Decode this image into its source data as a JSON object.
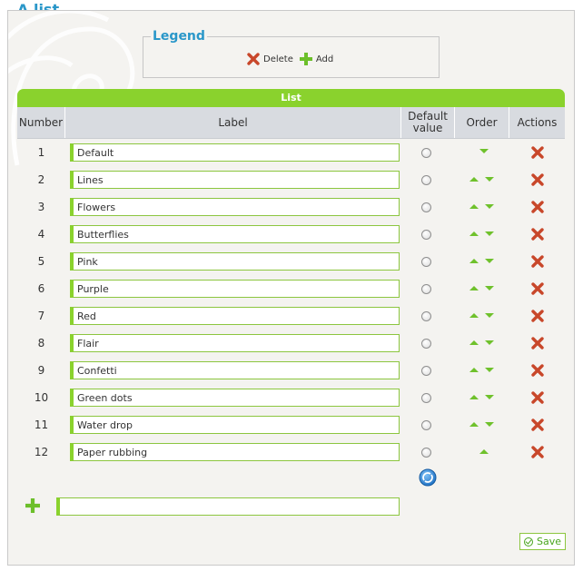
{
  "page": {
    "title": "A list"
  },
  "legend": {
    "title": "Legend",
    "delete_label": "Delete",
    "add_label": "Add"
  },
  "table": {
    "title": "List",
    "columns": [
      "Number",
      "Label",
      "Default value",
      "Order",
      "Actions"
    ],
    "rows": [
      {
        "number": "1",
        "label": "Default",
        "up": false,
        "down": true
      },
      {
        "number": "2",
        "label": "Lines",
        "up": true,
        "down": true
      },
      {
        "number": "3",
        "label": "Flowers",
        "up": true,
        "down": true
      },
      {
        "number": "4",
        "label": "Butterflies",
        "up": true,
        "down": true
      },
      {
        "number": "5",
        "label": "Pink",
        "up": true,
        "down": true
      },
      {
        "number": "6",
        "label": "Purple",
        "up": true,
        "down": true
      },
      {
        "number": "7",
        "label": "Red",
        "up": true,
        "down": true
      },
      {
        "number": "8",
        "label": "Flair",
        "up": true,
        "down": true
      },
      {
        "number": "9",
        "label": "Confetti",
        "up": true,
        "down": true
      },
      {
        "number": "10",
        "label": "Green dots",
        "up": true,
        "down": true
      },
      {
        "number": "11",
        "label": "Water drop",
        "up": true,
        "down": true
      },
      {
        "number": "12",
        "label": "Paper rubbing",
        "up": true,
        "down": false
      }
    ]
  },
  "new_item": {
    "value": ""
  },
  "actions": {
    "save_label": "Save"
  },
  "icons": {
    "delete": "delete-x-icon",
    "add": "add-plus-icon",
    "reset": "reset-radio-icon"
  },
  "colors": {
    "accent_green": "#8ad22d",
    "title_blue": "#2a97c9",
    "delete_red": "#c0392b"
  }
}
